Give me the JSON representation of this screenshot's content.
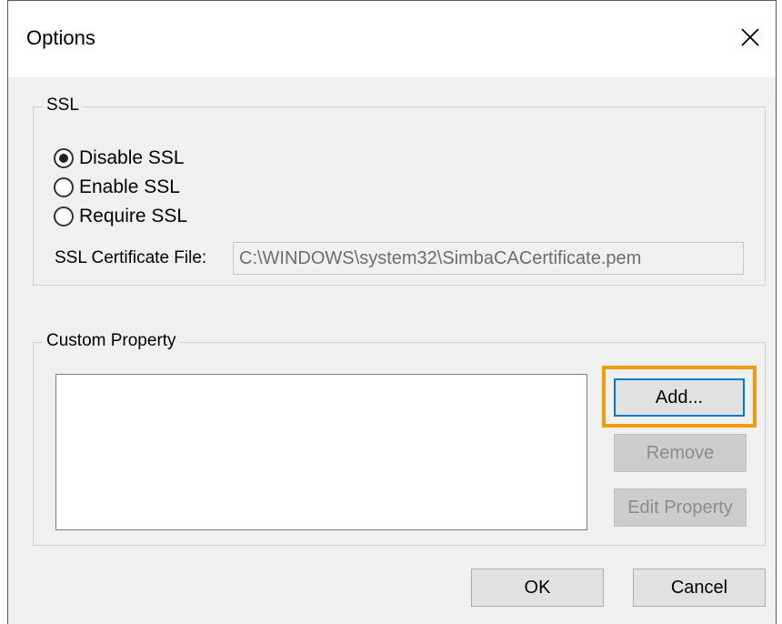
{
  "window": {
    "title": "Options",
    "close_icon": "close-icon"
  },
  "ssl_group": {
    "label": "SSL",
    "options": [
      {
        "label": "Disable SSL",
        "selected": true
      },
      {
        "label": "Enable SSL",
        "selected": false
      },
      {
        "label": "Require SSL",
        "selected": false
      }
    ],
    "cert_label": "SSL Certificate File:",
    "cert_value": "C:\\WINDOWS\\system32\\SimbaCACertificate.pem"
  },
  "custom_group": {
    "label": "Custom Property",
    "add_label": "Add...",
    "remove_label": "Remove",
    "edit_label": "Edit Property"
  },
  "footer": {
    "ok_label": "OK",
    "cancel_label": "Cancel"
  },
  "colors": {
    "highlight": "#f29b0f",
    "focus": "#0078d7"
  }
}
